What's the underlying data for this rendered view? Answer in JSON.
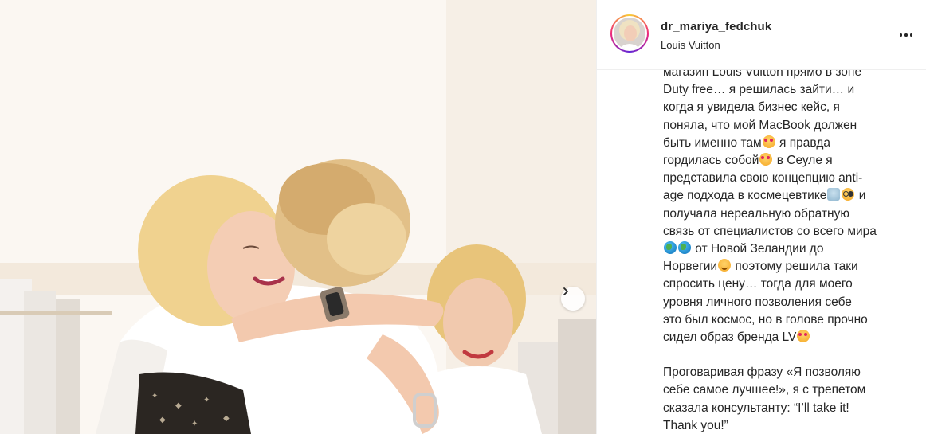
{
  "post": {
    "username": "dr_mariya_fedchuk",
    "location": "Louis Vuitton"
  },
  "icons": {
    "more": "more-horizontal-icon",
    "next": "chevron-right-icon",
    "emoji_smiling_hearts": "smiling-face-with-hearts",
    "emoji_smile": "smiling-face",
    "emoji_globe": "globe-icon",
    "emoji_woman": "woman-with-veil",
    "emoji_glasses": "face-with-glasses"
  },
  "caption": {
    "l1": "магазин Louis Vuitton прямо в зоне",
    "l2": "Duty free… я решилась зайти… и",
    "l3": "когда я увидела бизнес кейс, я",
    "l4": "поняла, что мой MacBook должен",
    "l5a": "быть именно там",
    "l5b": " я правда",
    "l6a": "гордилась собой",
    "l6b": " в Сеуле я",
    "l7": "представила свою концепцию anti-",
    "l8a": "age подхода в космецевтике",
    "l8b": " и",
    "l9": "получала нереальную обратную",
    "l10": "связь от специалистов со всего мира",
    "l11": " от Новой Зеландии до",
    "l12a": "Норвегии",
    "l12b": " поэтому решила таки",
    "l13": "спросить цену… тогда для моего",
    "l14": "уровня личного позволения себе",
    "l15": "это был космос, но в голове прочно",
    "l16": "сидел образ бренда LV",
    "p2l1": "Проговаривая фразу «Я позволяю",
    "p2l2": "себе самое лучшее!», я с трепетом",
    "p2l3": "сказала консультанту: “I’ll take it!",
    "p2l4": "Thank you!”"
  },
  "colors": {
    "text": "#262626",
    "divider": "#efefef",
    "story_ring_start": "#f9ce34",
    "story_ring_end": "#6228d7"
  }
}
